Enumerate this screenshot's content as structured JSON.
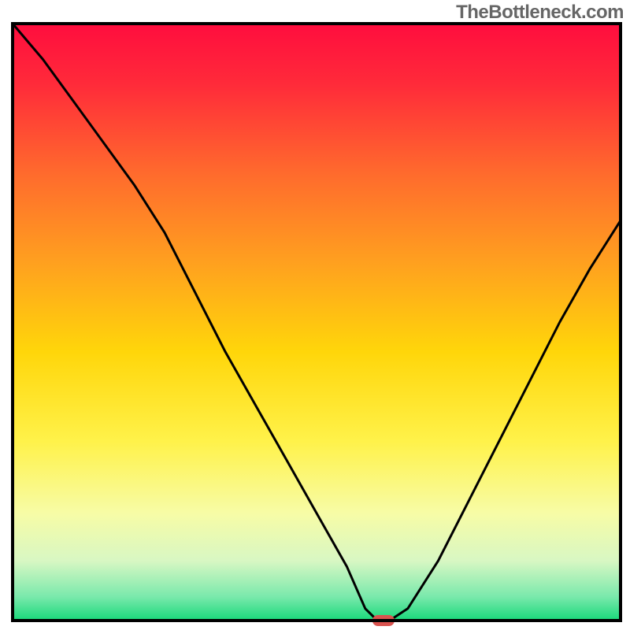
{
  "watermark": "TheBottleneck.com",
  "chart_data": {
    "type": "line",
    "title": "",
    "xlabel": "",
    "ylabel": "",
    "x": [
      0.0,
      0.05,
      0.1,
      0.15,
      0.2,
      0.25,
      0.3,
      0.35,
      0.4,
      0.45,
      0.5,
      0.55,
      0.58,
      0.6,
      0.62,
      0.65,
      0.7,
      0.75,
      0.8,
      0.85,
      0.9,
      0.95,
      1.0
    ],
    "values": [
      1.0,
      0.94,
      0.87,
      0.8,
      0.73,
      0.65,
      0.55,
      0.45,
      0.36,
      0.27,
      0.18,
      0.09,
      0.02,
      0.0,
      0.0,
      0.02,
      0.1,
      0.2,
      0.3,
      0.4,
      0.5,
      0.59,
      0.67
    ],
    "xlim": [
      0,
      1
    ],
    "ylim": [
      0,
      1
    ],
    "marker": {
      "x": 0.61,
      "y": 0.0,
      "color": "#d9534f",
      "rx": 14,
      "ry": 7
    },
    "gradient_stops": [
      {
        "offset": 0.0,
        "color": "#ff0d3e"
      },
      {
        "offset": 0.1,
        "color": "#ff2a3a"
      },
      {
        "offset": 0.25,
        "color": "#ff6a2d"
      },
      {
        "offset": 0.4,
        "color": "#ffa01f"
      },
      {
        "offset": 0.55,
        "color": "#ffd60a"
      },
      {
        "offset": 0.7,
        "color": "#fff24a"
      },
      {
        "offset": 0.82,
        "color": "#f7fca6"
      },
      {
        "offset": 0.9,
        "color": "#d8f7c3"
      },
      {
        "offset": 0.96,
        "color": "#7ae9ac"
      },
      {
        "offset": 1.0,
        "color": "#18d87a"
      }
    ],
    "border_color": "#000000",
    "curve_color": "#000000",
    "curve_width": 3
  }
}
